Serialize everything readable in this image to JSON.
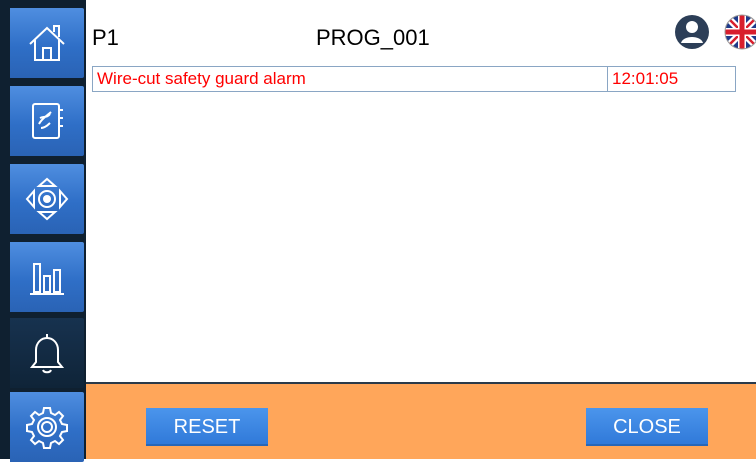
{
  "header": {
    "program_id": "P1",
    "program_name": "PROG_001",
    "user_icon": "user-avatar-icon",
    "language_icon": "uk-flag-icon"
  },
  "sidebar": {
    "items": [
      {
        "name": "home",
        "icon": "home-icon"
      },
      {
        "name": "program",
        "icon": "program-book-icon"
      },
      {
        "name": "manual-move",
        "icon": "move-arrows-icon"
      },
      {
        "name": "statistics",
        "icon": "bar-chart-icon"
      },
      {
        "name": "alarms",
        "icon": "bell-icon",
        "active": true
      },
      {
        "name": "settings",
        "icon": "gear-icon"
      }
    ]
  },
  "alarms": [
    {
      "message": "Wire-cut safety guard alarm",
      "time": "12:01:05"
    }
  ],
  "footer": {
    "reset_label": "RESET",
    "close_label": "CLOSE"
  },
  "colors": {
    "sidebar_bg": "#0f2030",
    "nav_button": "#2f6fc7",
    "footer_bg": "#ffa65a",
    "action_button": "#3b86e2",
    "alarm_text": "#ff0000"
  }
}
